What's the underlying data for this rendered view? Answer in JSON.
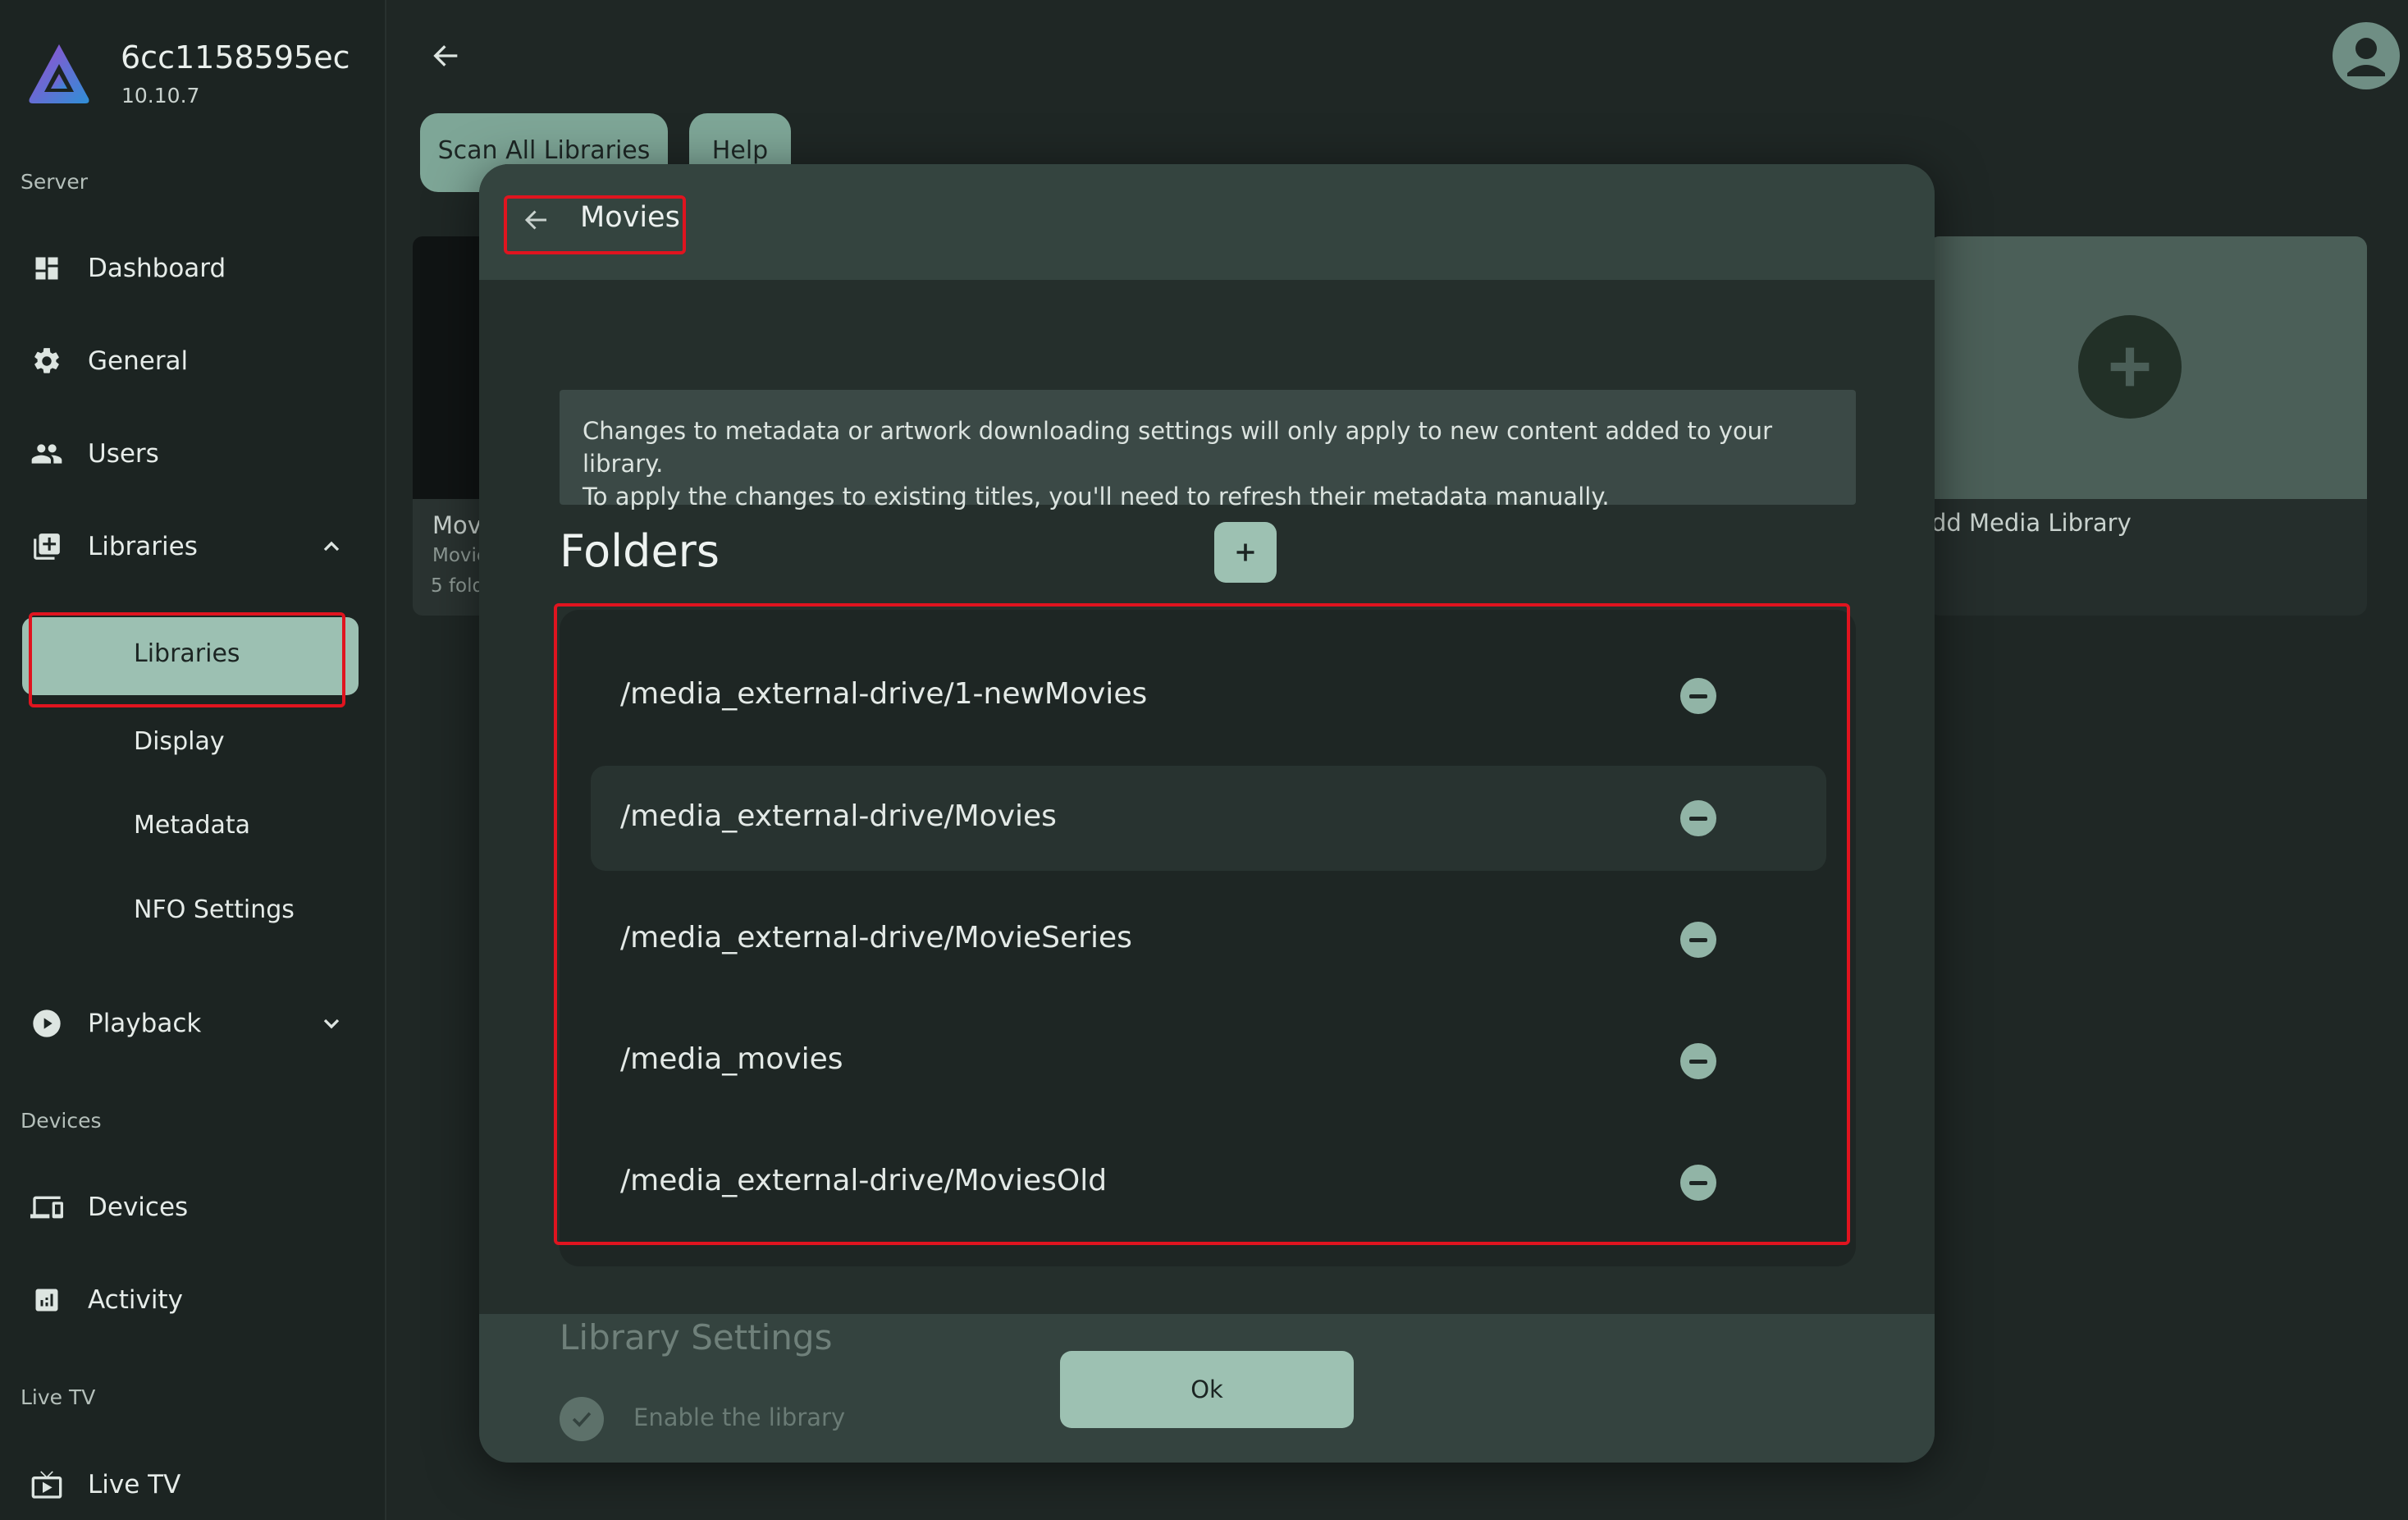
{
  "server": {
    "name": "6cc1158595ec",
    "version": "10.10.7"
  },
  "sidebar": {
    "section_server": "Server",
    "items_server": [
      {
        "label": "Dashboard",
        "icon": "dashboard-icon"
      },
      {
        "label": "General",
        "icon": "gear-icon"
      },
      {
        "label": "Users",
        "icon": "users-icon"
      },
      {
        "label": "Libraries",
        "icon": "library-add-icon",
        "expanded": true
      }
    ],
    "library_subitems": [
      "Libraries",
      "Display",
      "Metadata",
      "NFO Settings"
    ],
    "playback": {
      "label": "Playback",
      "icon": "play-circle-icon"
    },
    "section_devices": "Devices",
    "items_devices": [
      {
        "label": "Devices",
        "icon": "devices-icon"
      },
      {
        "label": "Activity",
        "icon": "activity-icon"
      }
    ],
    "section_livetv": "Live TV",
    "livetv": {
      "label": "Live TV",
      "icon": "live-tv-icon"
    }
  },
  "toolbar": {
    "scan_label": "Scan All Libraries",
    "help_label": "Help"
  },
  "cards": {
    "left_title": "Mov",
    "left_sub": "Movie",
    "left_sub2": "5 fold",
    "add_label": "dd Media Library"
  },
  "dialog": {
    "title": "Movies",
    "notice_line1": "Changes to metadata or artwork downloading settings will only apply to new content added to your library.",
    "notice_line2": "To apply the changes to existing titles, you'll need to refresh their metadata manually.",
    "folders_heading": "Folders",
    "folders": [
      "/media_external-drive/1-newMovies",
      "/media_external-drive/Movies",
      "/media_external-drive/MovieSeries",
      "/media_movies",
      "/media_external-drive/MoviesOld"
    ],
    "library_settings_heading": "Library Settings",
    "enable_library_label": "Enable the library",
    "ok_label": "Ok"
  },
  "colors": {
    "accent": "#9dc1b2",
    "highlight": "#e0141f"
  }
}
